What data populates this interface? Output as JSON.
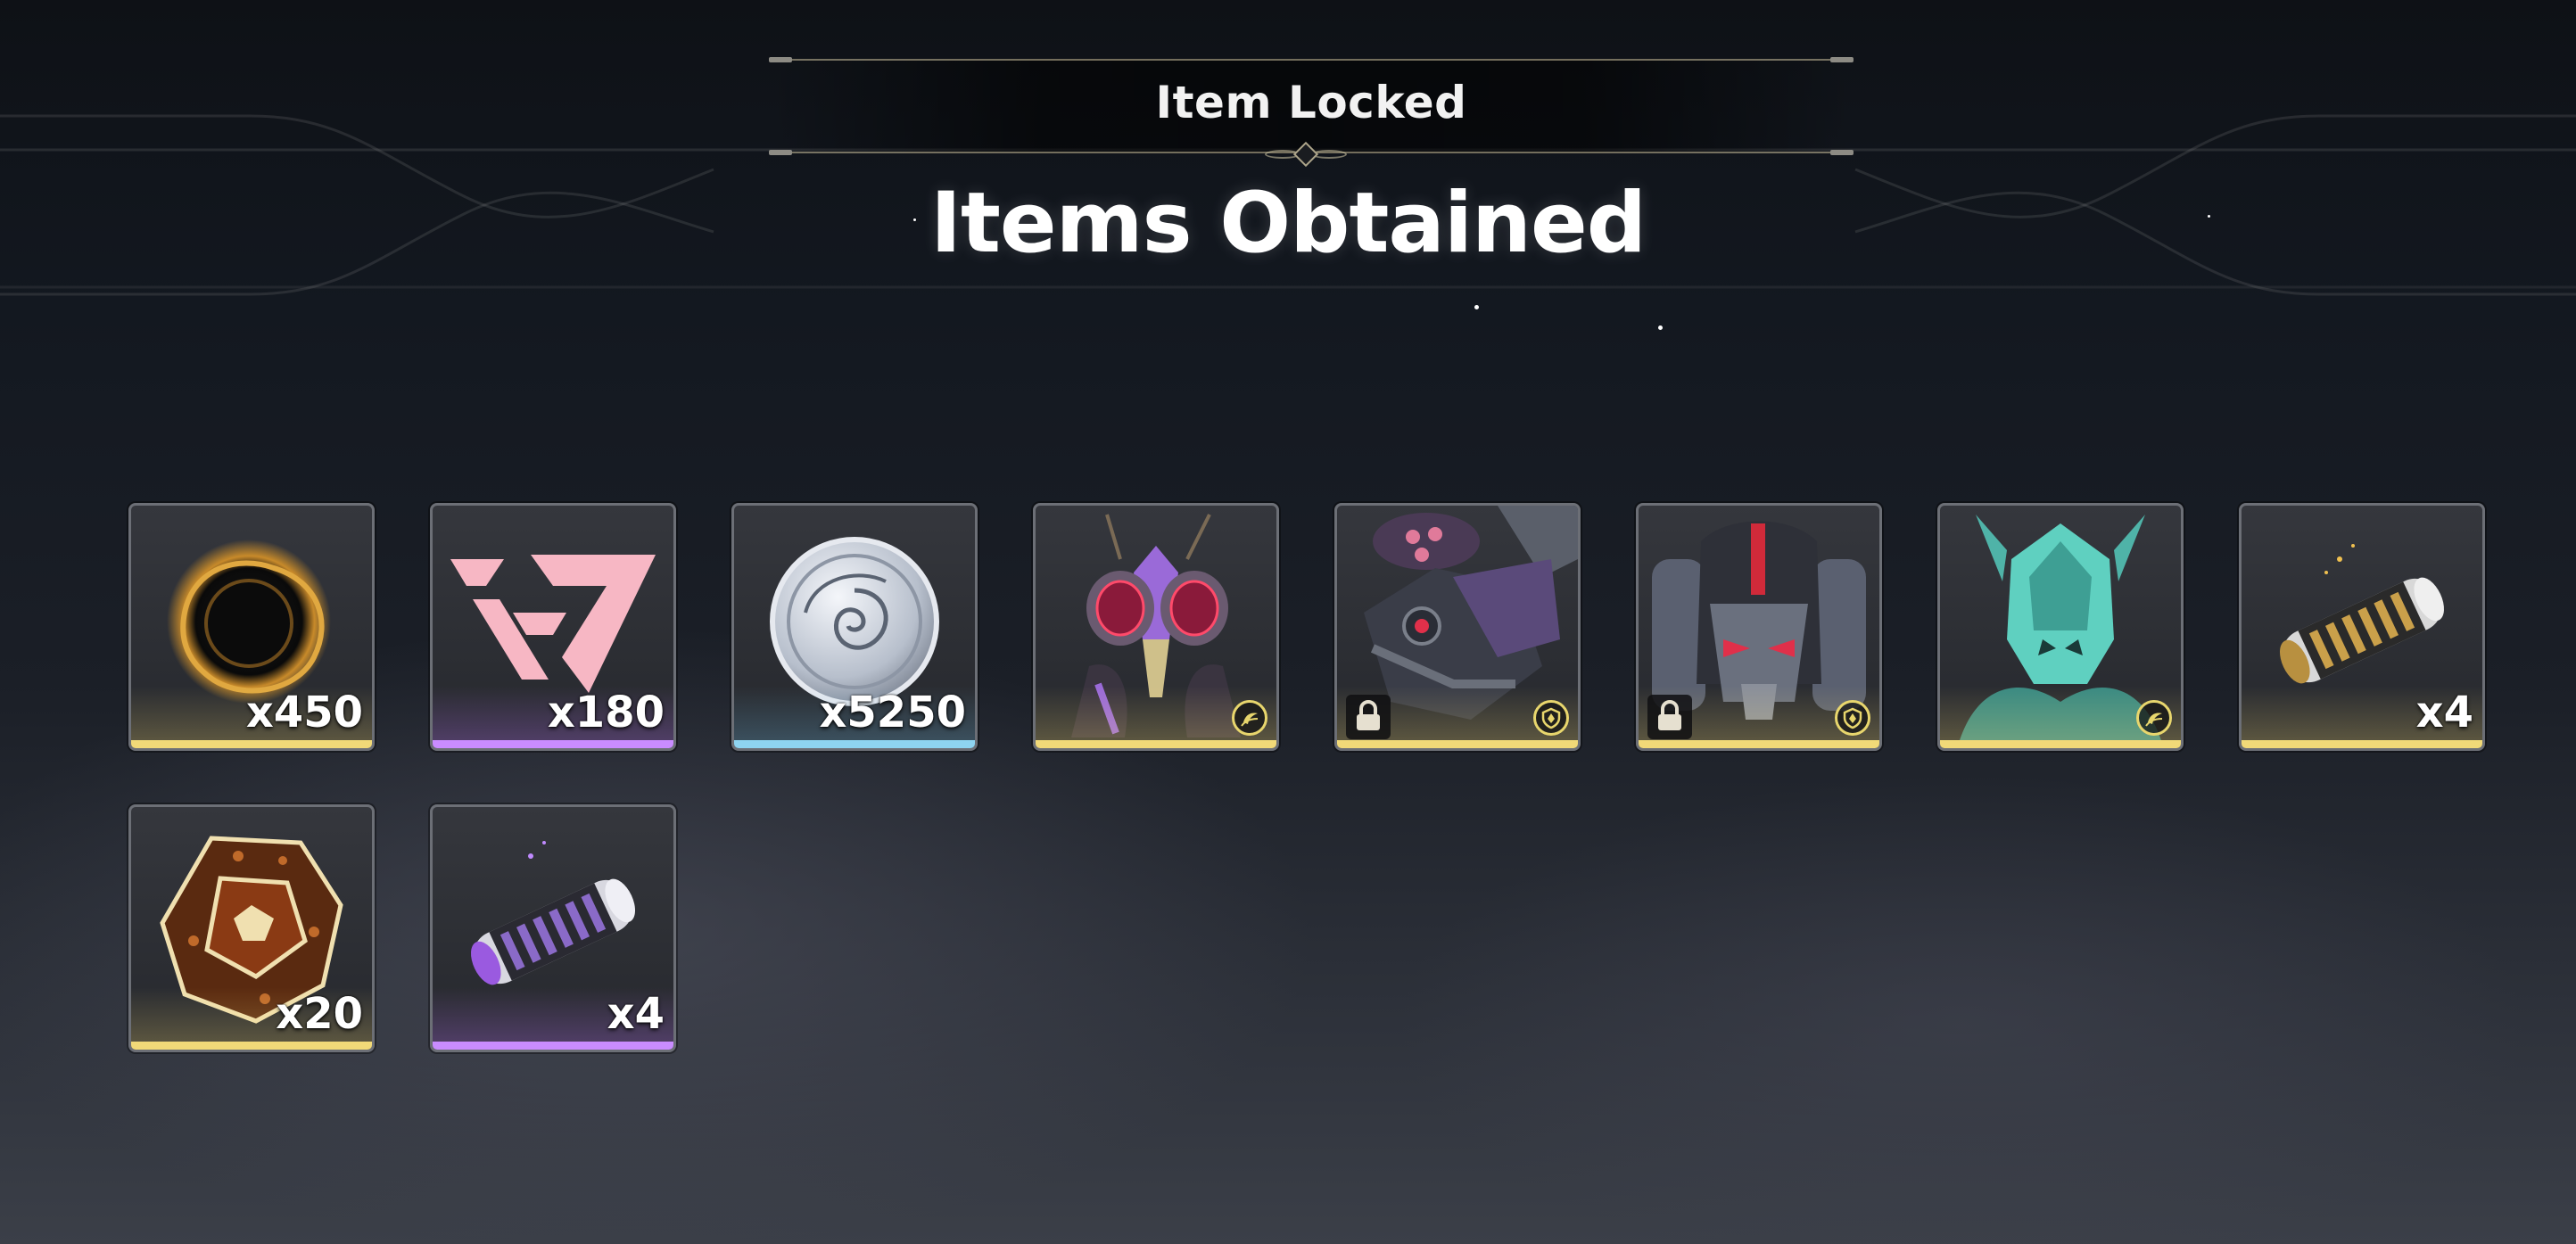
{
  "header": {
    "subtitle": "Item Locked",
    "title": "Items Obtained"
  },
  "colors": {
    "rarity_gold": "#f1d978",
    "rarity_purple": "#c98cff",
    "rarity_blue": "#8ed4f0",
    "badge_ring": "#e8d66d"
  },
  "items": [
    {
      "quantity": "x450",
      "rarity": "gold",
      "icon": "dark-orb-icon"
    },
    {
      "quantity": "x180",
      "rarity": "purple",
      "icon": "pink-emblem-icon"
    },
    {
      "quantity": "x5250",
      "rarity": "blue",
      "icon": "silver-coin-icon"
    },
    {
      "rarity": "gold",
      "icon": "purple-insect-echo-icon",
      "badge": "crescent-moon-icon"
    },
    {
      "rarity": "gold",
      "icon": "mech-beast-echo-icon",
      "badge": "shield-icon",
      "locked": true
    },
    {
      "rarity": "gold",
      "icon": "armored-robot-echo-icon",
      "badge": "shield-icon",
      "locked": true
    },
    {
      "rarity": "gold",
      "icon": "crystal-knight-echo-icon",
      "badge": "crescent-moon-icon"
    },
    {
      "quantity": "x4",
      "rarity": "gold",
      "icon": "gold-tuner-cylinder-icon"
    },
    {
      "quantity": "x20",
      "rarity": "gold",
      "icon": "bronze-polyhedron-icon"
    },
    {
      "quantity": "x4",
      "rarity": "purple",
      "icon": "purple-tuner-cylinder-icon"
    }
  ]
}
